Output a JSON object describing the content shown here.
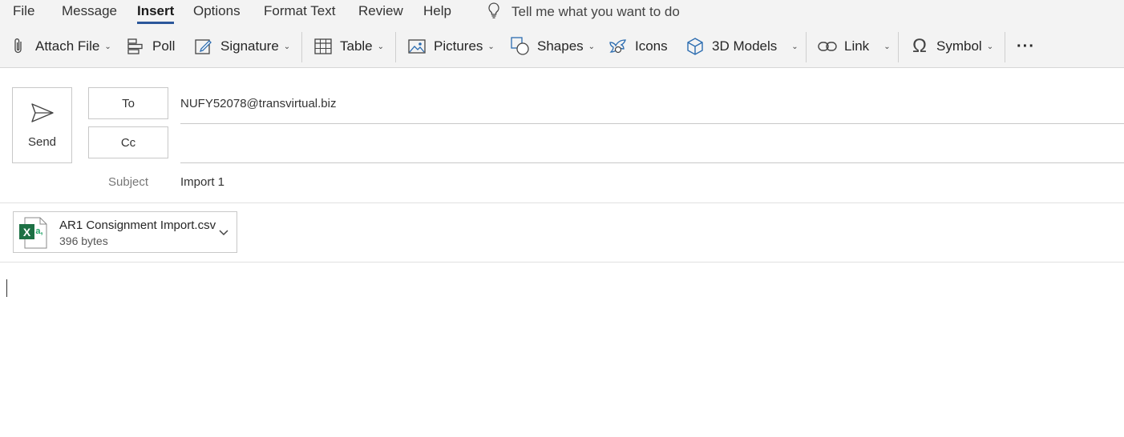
{
  "menu": {
    "file": "File",
    "message": "Message",
    "insert": "Insert",
    "options": "Options",
    "format_text": "Format Text",
    "review": "Review",
    "help": "Help",
    "tell_me": "Tell me what you want to do"
  },
  "toolbar": {
    "attach_file": "Attach File",
    "poll": "Poll",
    "signature": "Signature",
    "table": "Table",
    "pictures": "Pictures",
    "shapes": "Shapes",
    "icons": "Icons",
    "models_3d": "3D Models",
    "link": "Link",
    "symbol": "Symbol",
    "more": "···"
  },
  "compose": {
    "send_label": "Send",
    "to_label": "To",
    "cc_label": "Cc",
    "to_value": "NUFY52078@transvirtual.biz",
    "cc_value": "",
    "subject_label": "Subject",
    "subject_value": "Import 1"
  },
  "attachment": {
    "name": "AR1 Consignment Import.csv",
    "size": "396 bytes",
    "icon": "excel-csv-icon"
  },
  "colors": {
    "accent": "#2b579a",
    "ribbon_bg": "#f3f3f3",
    "excel_green": "#1d7044",
    "icon_blue": "#2b6cb0"
  }
}
